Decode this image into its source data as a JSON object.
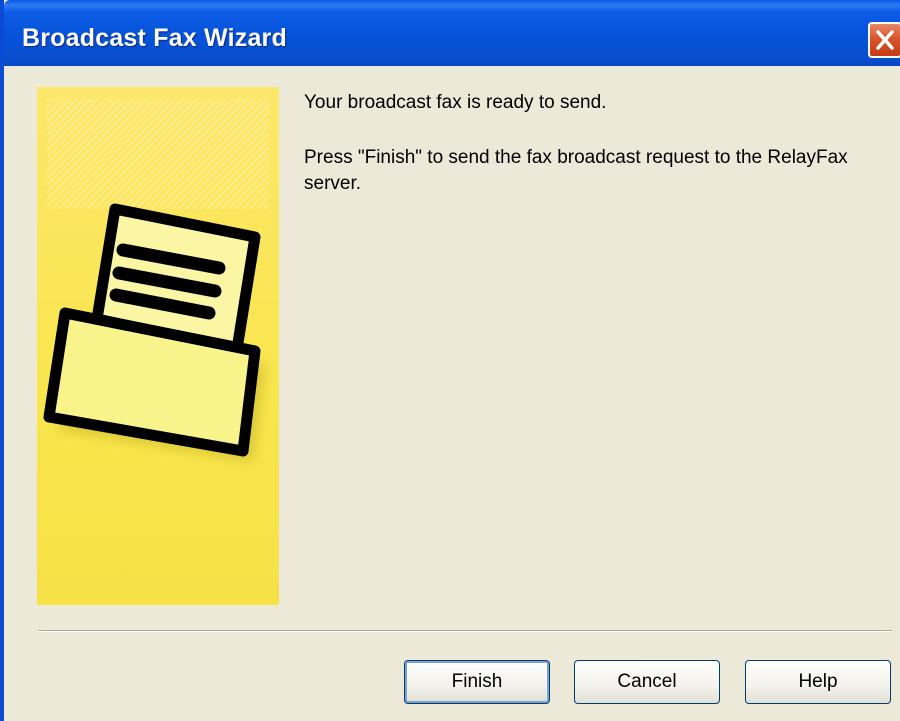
{
  "window": {
    "title": "Broadcast Fax Wizard",
    "close_icon": "close-icon"
  },
  "side_panel": {
    "art_icon": "fax-document-icon",
    "colors": {
      "panel": "#f9e64c",
      "document": "#fbf6a3",
      "tray": "#f8f38a",
      "outline": "#000000"
    }
  },
  "content": {
    "message_ready": "Your broadcast fax is ready to send.",
    "message_instruction": "Press \"Finish\" to send the fax broadcast request to the RelayFax server."
  },
  "buttons": {
    "finish": "Finish",
    "cancel": "Cancel",
    "help": "Help"
  },
  "colors": {
    "titlebar": "#0552d8",
    "dialog_bg": "#ece9d8",
    "close_button": "#d8552e"
  }
}
